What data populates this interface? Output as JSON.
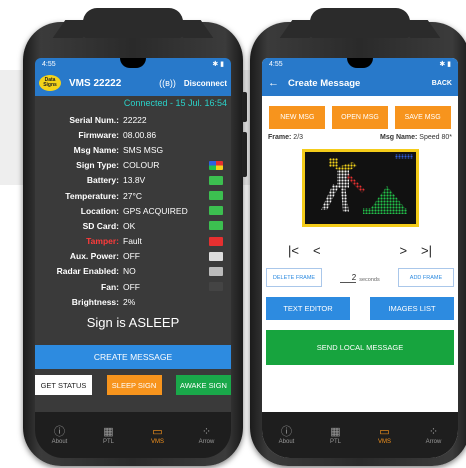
{
  "left": {
    "status_time": "4:55",
    "status_right": "✱ ▮",
    "logo_text": "Data Signs",
    "title": "VMS 22222",
    "bt_icon": "bluetooth-icon",
    "disconnect_label": "Disconnect",
    "connection": "Connected - 15 Jul. 16:54",
    "fields": [
      {
        "key": "Serial Num.:",
        "value": "22222",
        "icon": ""
      },
      {
        "key": "Firmware:",
        "value": "08.00.86",
        "icon": ""
      },
      {
        "key": "Msg Name:",
        "value": "SMS MSG",
        "icon": ""
      },
      {
        "key": "Sign Type:",
        "value": "COLOUR",
        "icon": "colour-icon"
      },
      {
        "key": "Battery:",
        "value": "13.8V",
        "icon": "battery-icon"
      },
      {
        "key": "Temperature:",
        "value": "27°C",
        "icon": "thermometer-icon"
      },
      {
        "key": "Location:",
        "value": "GPS ACQUIRED",
        "icon": "location-pin-icon"
      },
      {
        "key": "SD Card:",
        "value": "OK",
        "icon": "sd-card-icon"
      },
      {
        "key": "Tamper:",
        "value": "Fault",
        "icon": "hand-icon"
      },
      {
        "key": "Aux. Power:",
        "value": "OFF",
        "icon": "plug-icon"
      },
      {
        "key": "Radar Enabled:",
        "value": "NO",
        "icon": "radar-icon"
      },
      {
        "key": "Fan:",
        "value": "OFF",
        "icon": "fan-icon"
      },
      {
        "key": "Brightness:",
        "value": "2%",
        "icon": ""
      }
    ],
    "sign_state": "Sign is ASLEEP",
    "create_label": "CREATE MESSAGE",
    "get_status_label": "GET STATUS",
    "sleep_label": "SLEEP SIGN",
    "awake_label": "AWAKE SIGN"
  },
  "nav": {
    "items": [
      {
        "label": "About",
        "icon": "info-icon"
      },
      {
        "label": "PTL",
        "icon": "traffic-light-icon"
      },
      {
        "label": "VMS",
        "icon": "vms-sign-icon"
      },
      {
        "label": "Arrow",
        "icon": "arrow-board-icon"
      }
    ],
    "active": "VMS"
  },
  "right": {
    "status_time": "4:55",
    "status_right": "✱ ▮",
    "title": "Create Message",
    "back_label": "BACK",
    "new_msg_label": "NEW MSG",
    "open_msg_label": "OPEN MSG",
    "save_msg_label": "SAVE MSG",
    "frame_label": "Frame:",
    "frame_value": "2/3",
    "msg_name_label": "Msg Name:",
    "msg_name_value": "Speed 80*",
    "delete_frame_label": "DELETE FRAME",
    "seconds_value": "2",
    "seconds_unit": "seconds",
    "add_frame_label": "ADD FRAME",
    "text_editor_label": "TEXT EDITOR",
    "images_list_label": "IMAGES LIST",
    "send_label": "SEND LOCAL MESSAGE"
  },
  "colors": {
    "header_blue": "#2879ca",
    "button_blue": "#2d8be0",
    "orange": "#f7941d",
    "green": "#17a43e",
    "teal": "#2ad2c9",
    "tamper_red": "#ff3b3b"
  }
}
